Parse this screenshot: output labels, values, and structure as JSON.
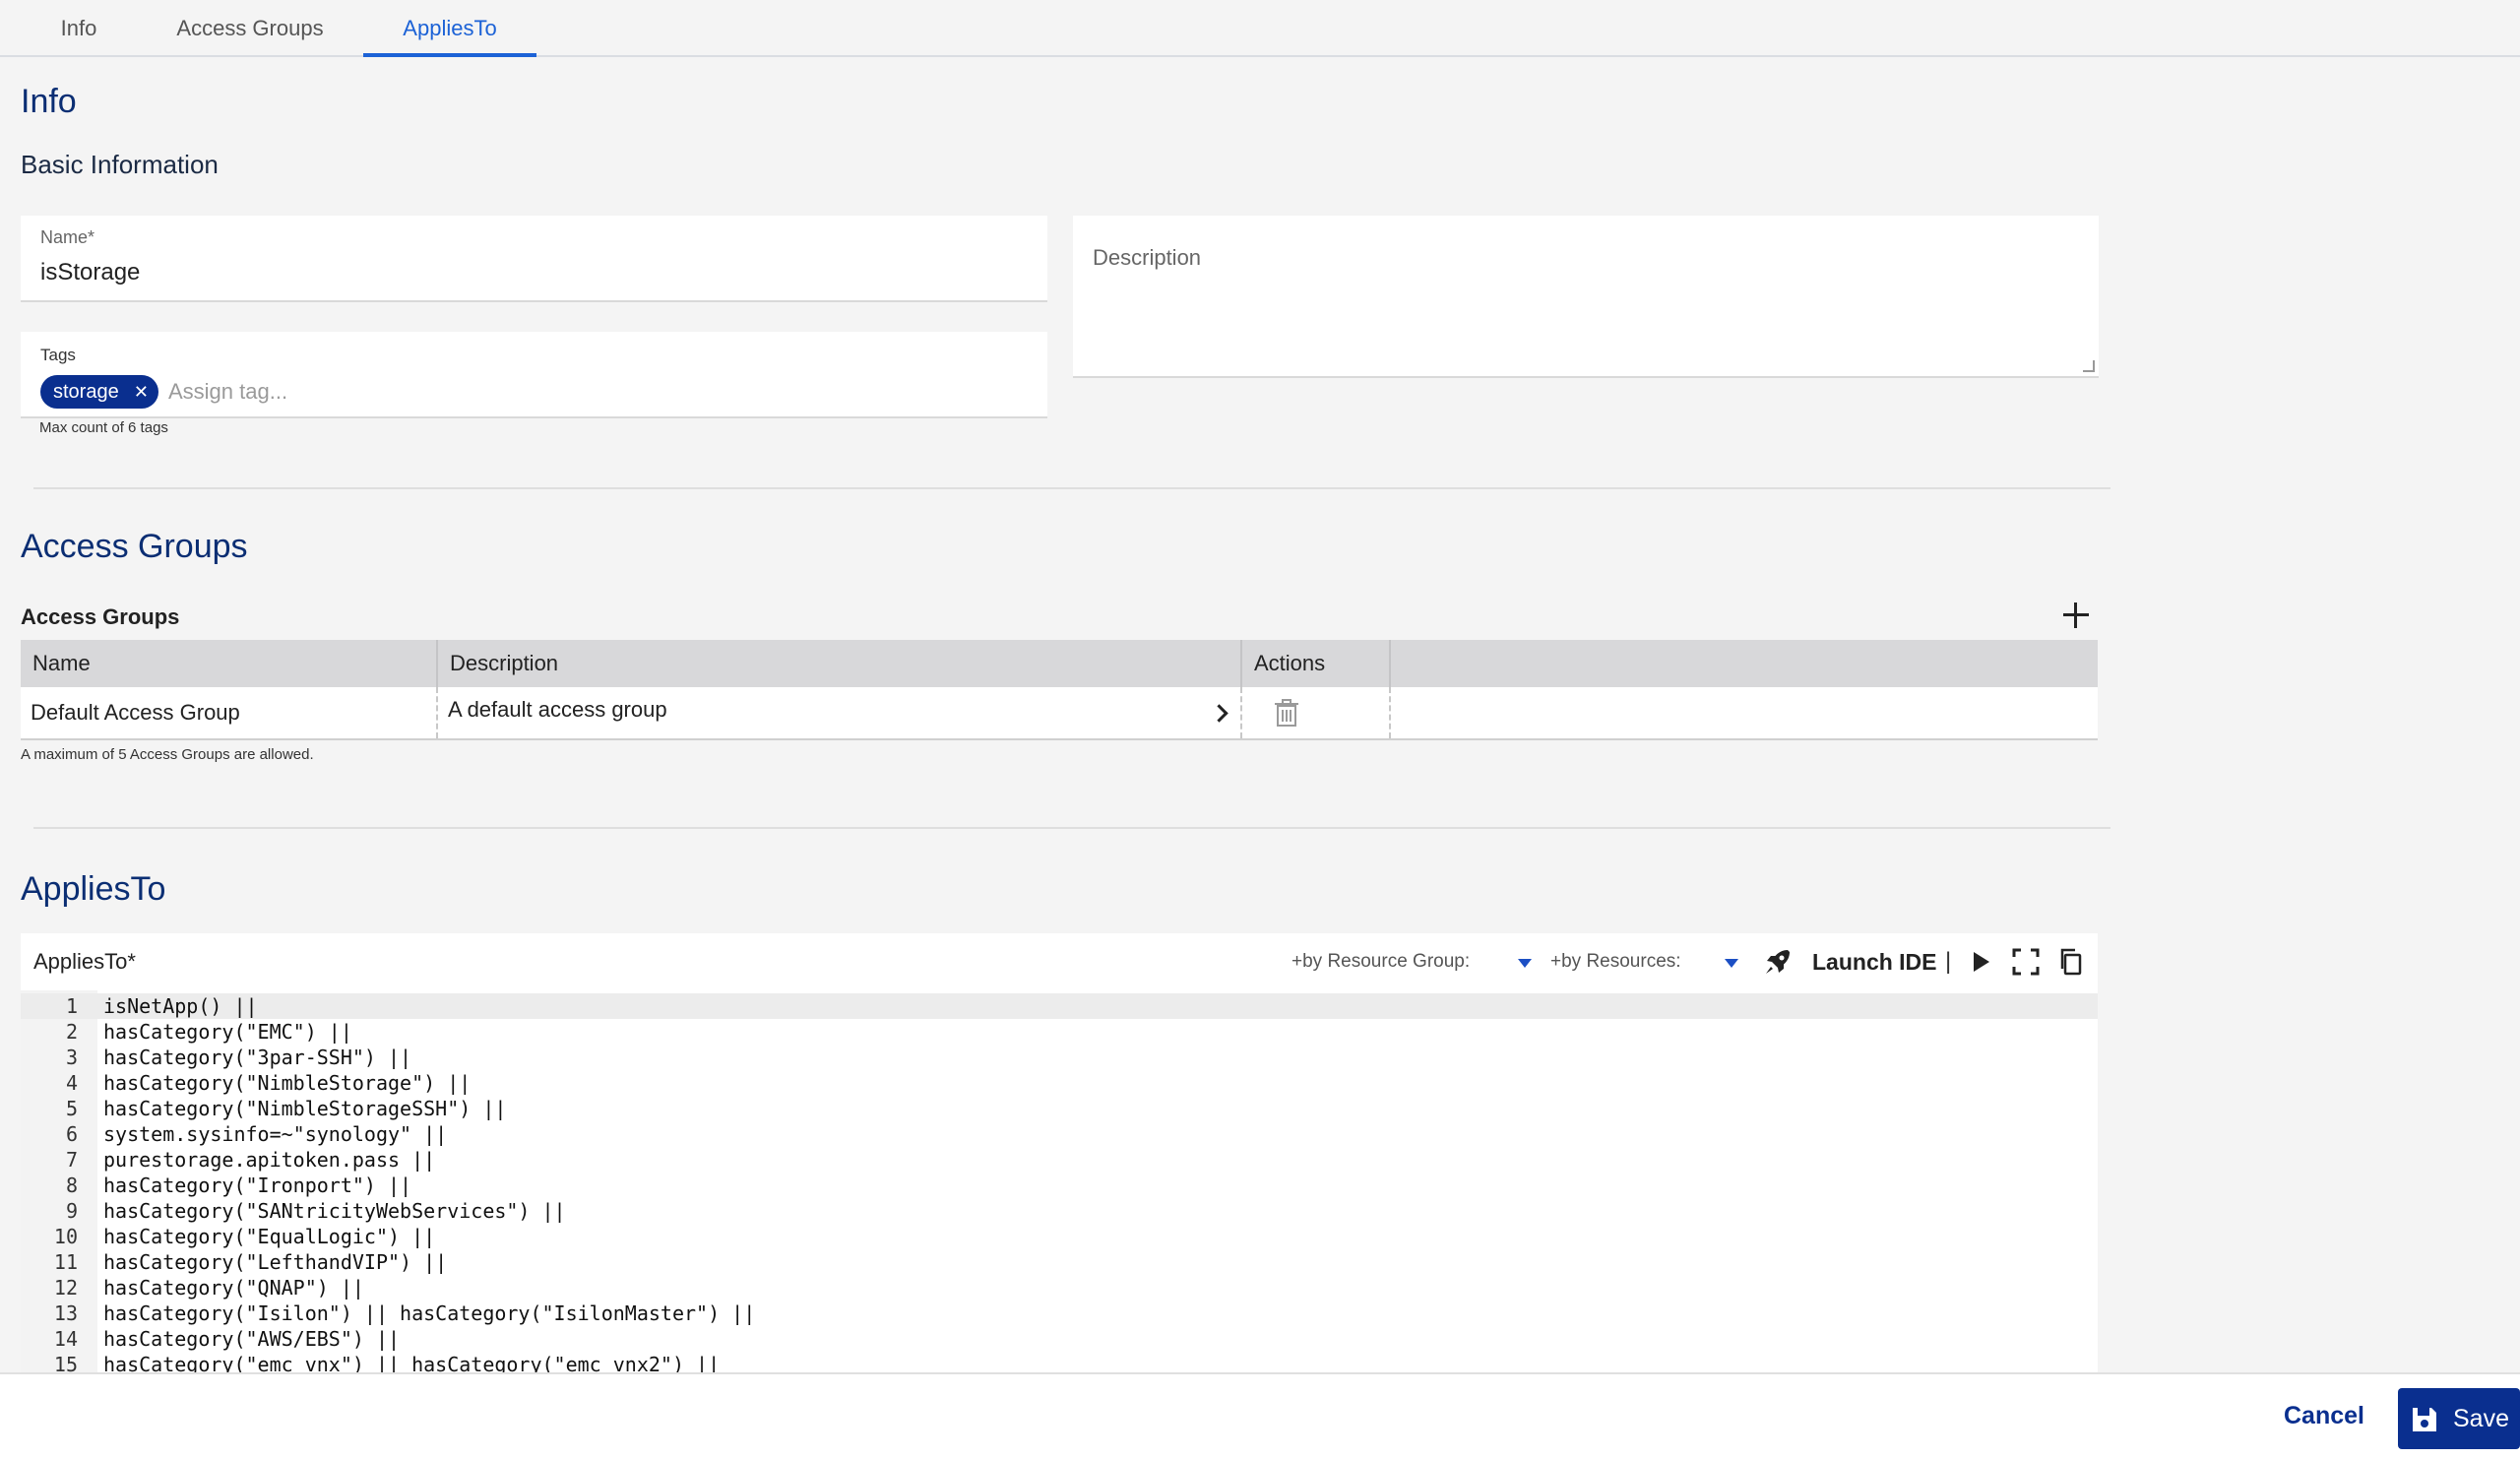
{
  "tabs": [
    {
      "label": "Info",
      "active": false
    },
    {
      "label": "Access Groups",
      "active": false
    },
    {
      "label": "AppliesTo",
      "active": true
    }
  ],
  "info": {
    "section_title": "Info",
    "subsection_title": "Basic Information",
    "name_label": "Name*",
    "name_value": "isStorage",
    "description_label": "Description",
    "tags_label": "Tags",
    "tags": [
      "storage"
    ],
    "tag_placeholder": "Assign tag...",
    "tags_hint": "Max count of 6 tags"
  },
  "access_groups": {
    "section_title": "Access Groups",
    "table_title": "Access Groups",
    "columns": [
      "Name",
      "Description",
      "Actions"
    ],
    "rows": [
      {
        "name": "Default Access Group",
        "description": "A default access group"
      }
    ],
    "hint": "A maximum of 5 Access Groups are allowed."
  },
  "applies_to": {
    "section_title": "AppliesTo",
    "editor_label": "AppliesTo*",
    "by_resource_group": "+by Resource Group:",
    "by_resources": "+by Resources:",
    "launch_ide": "Launch IDE",
    "separator": "|",
    "current_line": 1,
    "lines": [
      {
        "n": "1",
        "code": "isNetApp() ||"
      },
      {
        "n": "2",
        "code": "hasCategory(\"EMC\") ||"
      },
      {
        "n": "3",
        "code": "hasCategory(\"3par-SSH\") ||"
      },
      {
        "n": "4",
        "code": "hasCategory(\"NimbleStorage\") ||"
      },
      {
        "n": "5",
        "code": "hasCategory(\"NimbleStorageSSH\") ||"
      },
      {
        "n": "6",
        "code": "system.sysinfo=~\"synology\" ||"
      },
      {
        "n": "7",
        "code": "purestorage.apitoken.pass ||"
      },
      {
        "n": "8",
        "code": "hasCategory(\"Ironport\") ||"
      },
      {
        "n": "9",
        "code": "hasCategory(\"SANtricityWebServices\") ||"
      },
      {
        "n": "10",
        "code": "hasCategory(\"EqualLogic\") ||"
      },
      {
        "n": "11",
        "code": "hasCategory(\"LefthandVIP\") ||"
      },
      {
        "n": "12",
        "code": "hasCategory(\"QNAP\") ||"
      },
      {
        "n": "13",
        "code": "hasCategory(\"Isilon\") || hasCategory(\"IsilonMaster\") ||"
      },
      {
        "n": "14",
        "code": "hasCategory(\"AWS/EBS\") ||"
      },
      {
        "n": "15",
        "code": "hasCategory(\"emc_vnx\") || hasCategory(\"emc_vnx2\") ||"
      }
    ]
  },
  "footer": {
    "cancel_label": "Cancel",
    "save_label": "Save"
  },
  "colors": {
    "accent": "#1c62d6",
    "brand_dark": "#0a2f8f",
    "section_title": "#0b2e73"
  }
}
